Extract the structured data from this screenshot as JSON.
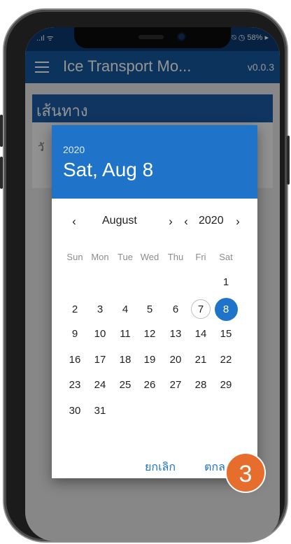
{
  "status_bar": {
    "left": "..ıl ᯤ",
    "right": "⍉ ◷ 58% ▸"
  },
  "app_bar": {
    "title": "Ice Transport Mo...",
    "version": "v0.0.3"
  },
  "section": {
    "title": "เส้นทาง"
  },
  "card": {
    "label": "วั"
  },
  "date_picker": {
    "header_year": "2020",
    "header_date": "Sat, Aug 8",
    "month": "August",
    "year": "2020",
    "prev_symbol": "‹",
    "next_symbol": "›",
    "weekdays": [
      "Sun",
      "Mon",
      "Tue",
      "Wed",
      "Thu",
      "Fri",
      "Sat"
    ],
    "weeks": [
      [
        "",
        "",
        "",
        "",
        "",
        "",
        "1"
      ],
      [
        "2",
        "3",
        "4",
        "5",
        "6",
        "7",
        "8"
      ],
      [
        "9",
        "10",
        "11",
        "12",
        "13",
        "14",
        "15"
      ],
      [
        "16",
        "17",
        "18",
        "19",
        "20",
        "21",
        "22"
      ],
      [
        "23",
        "24",
        "25",
        "26",
        "27",
        "28",
        "29"
      ],
      [
        "30",
        "31",
        "",
        "",
        "",
        "",
        ""
      ]
    ],
    "today": "7",
    "selected": "8",
    "cancel_label": "ยกเลิก",
    "ok_label": "ตกลง"
  },
  "step_badge": "3",
  "colors": {
    "app_bar": "#15589f",
    "dialog_header": "#1f74c9",
    "badge": "#e66d2c"
  }
}
